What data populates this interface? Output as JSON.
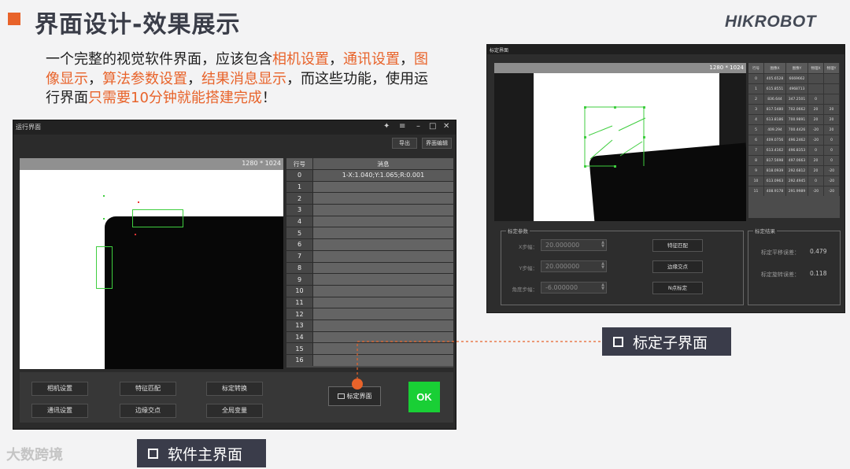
{
  "header": {
    "title": "界面设计-效果展示",
    "brand": "HIKROBOT"
  },
  "intro": {
    "parts": [
      {
        "text": "一个完整的视觉软件界面，应该包含",
        "hl": false
      },
      {
        "text": "相机设置",
        "hl": true
      },
      {
        "text": "，",
        "hl": false
      },
      {
        "text": "通讯设置",
        "hl": true
      },
      {
        "text": "，",
        "hl": false
      },
      {
        "text": "图像显示",
        "hl": true
      },
      {
        "text": "，",
        "hl": false
      },
      {
        "text": "算法参数设置",
        "hl": true
      },
      {
        "text": "，",
        "hl": false
      },
      {
        "text": "结果消息显示",
        "hl": true
      },
      {
        "text": "，而这些功能，使用运行界面",
        "hl": false
      },
      {
        "text": "只需要10分钟就能搭建完成",
        "hl": true
      },
      {
        "text": "！",
        "hl": false
      }
    ]
  },
  "main_window": {
    "title": "运行界面",
    "controls": {
      "pin": "✦",
      "menu": "≡",
      "minimize": "–",
      "maximize": "□",
      "close": "✕"
    },
    "toolbar": {
      "export": "导出",
      "edit": "界面编辑"
    },
    "image": {
      "resolution": "1280 * 1024"
    },
    "message_table": {
      "headers": [
        "行号",
        "消息"
      ],
      "rows": [
        {
          "no": "0",
          "msg": "1-X:1.040;Y:1.065;R:0.001"
        },
        {
          "no": "1",
          "msg": ""
        },
        {
          "no": "2",
          "msg": ""
        },
        {
          "no": "3",
          "msg": ""
        },
        {
          "no": "4",
          "msg": ""
        },
        {
          "no": "5",
          "msg": ""
        },
        {
          "no": "6",
          "msg": ""
        },
        {
          "no": "7",
          "msg": ""
        },
        {
          "no": "8",
          "msg": ""
        },
        {
          "no": "9",
          "msg": ""
        },
        {
          "no": "10",
          "msg": ""
        },
        {
          "no": "11",
          "msg": ""
        },
        {
          "no": "12",
          "msg": ""
        },
        {
          "no": "13",
          "msg": ""
        },
        {
          "no": "14",
          "msg": ""
        },
        {
          "no": "15",
          "msg": ""
        },
        {
          "no": "16",
          "msg": ""
        }
      ]
    },
    "buttons": {
      "camera": "相机设置",
      "feature_match": "特征匹配",
      "calib_convert": "标定转换",
      "comm": "通讯设置",
      "edge_cross": "边缘交点",
      "global_var": "全局变量",
      "calib_ui": "标定界面",
      "ok": "OK"
    }
  },
  "sub_window": {
    "title": "标定界面",
    "image": {
      "resolution": "1280 * 1024"
    },
    "table": {
      "headers": [
        "行号",
        "图像X",
        "图像Y",
        "物理X",
        "物理Y"
      ],
      "rows": [
        [
          "0",
          "405.6528",
          "6669662",
          "",
          ""
        ],
        [
          "1",
          "615.8551",
          "4968713",
          "",
          ""
        ],
        [
          "2",
          "836.644",
          "347.2501",
          "0",
          ""
        ],
        [
          "3",
          "817.5480",
          "702.0662",
          "20",
          "20"
        ],
        [
          "4",
          "613.8186",
          "700.9891",
          "20",
          "20"
        ],
        [
          "5",
          "409.294",
          "700.4426",
          "-20",
          "20"
        ],
        [
          "6",
          "409.0756",
          "496.2462",
          "-20",
          "0"
        ],
        [
          "7",
          "613.4162",
          "496.8353",
          "0",
          "0"
        ],
        [
          "8",
          "817.5698",
          "497.0663",
          "20",
          "0"
        ],
        [
          "9",
          "818.0939",
          "292.6812",
          "20",
          "-20"
        ],
        [
          "10",
          "613.0963",
          "292.4945",
          "0",
          "-20"
        ],
        [
          "11",
          "408.9178",
          "291.9989",
          "-20",
          "-20"
        ]
      ]
    },
    "params": {
      "title": "标定参数",
      "x_step_label": "X步幅：",
      "x_step": "20.000000",
      "y_step_label": "Y步幅：",
      "y_step": "20.000000",
      "angle_step_label": "角度步幅：",
      "angle_step": "-6.000000",
      "btn_feature": "特征匹配",
      "btn_edge": "边缘交点",
      "btn_npoint": "N点标定"
    },
    "result": {
      "title": "标定结果",
      "trans_error_label": "标定平移误差：",
      "trans_error": "0.479",
      "rot_error_label": "标定旋转误差：",
      "rot_error": "0.118"
    }
  },
  "callouts": {
    "calib_sub": "标定子界面",
    "main_ui": "软件主界面"
  },
  "watermark": "大数跨境",
  "colors": {
    "accent": "#e8632a",
    "ok_green": "#19cf35",
    "roi_green": "#3fce3f",
    "callout_bg": "#3a3c4a"
  }
}
